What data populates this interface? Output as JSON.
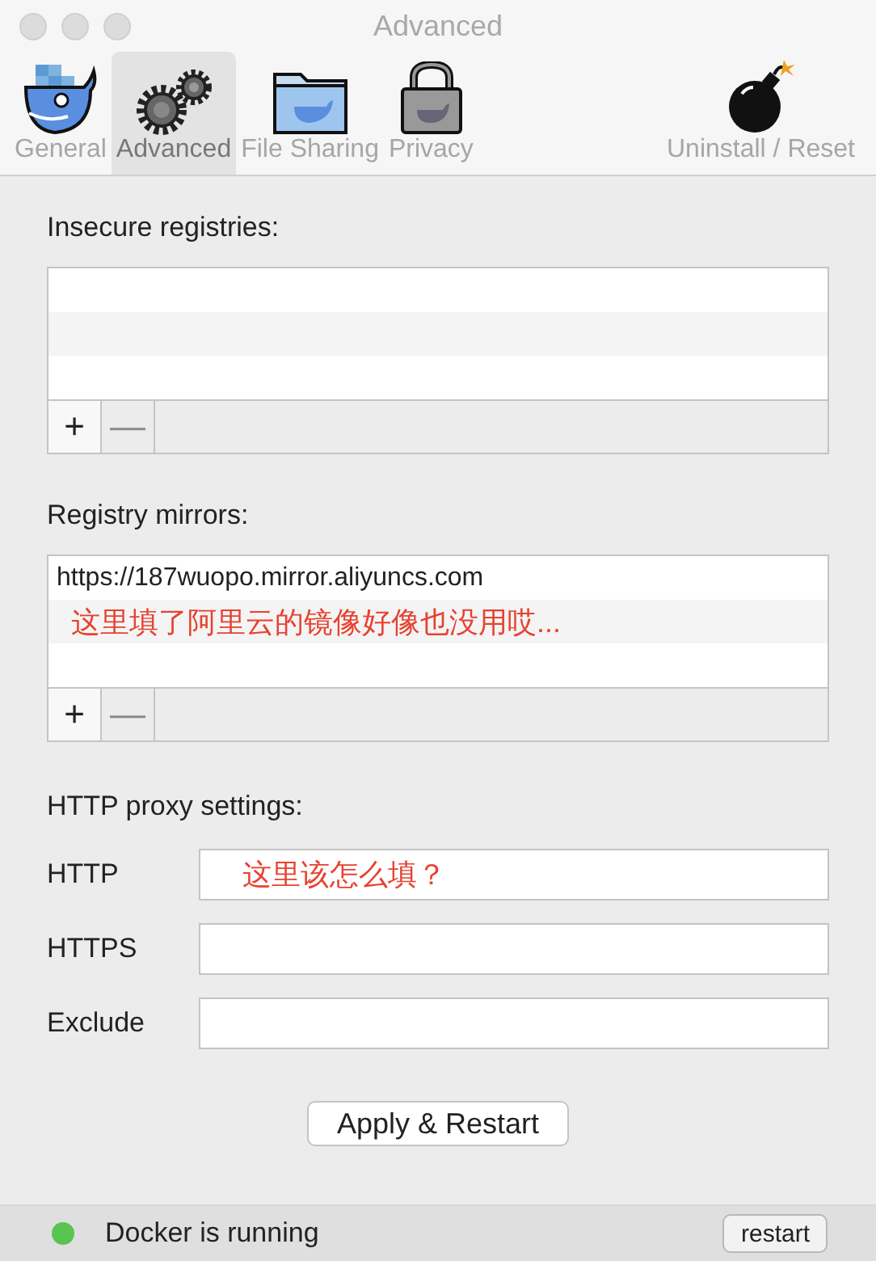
{
  "window": {
    "title": "Advanced"
  },
  "tabs": [
    {
      "label": "General",
      "selected": false
    },
    {
      "label": "Advanced",
      "selected": true
    },
    {
      "label": "File Sharing",
      "selected": false
    },
    {
      "label": "Privacy",
      "selected": false
    },
    {
      "label": "Uninstall / Reset",
      "selected": false
    }
  ],
  "insecure_registries": {
    "label": "Insecure registries:",
    "add": {
      "label": "+",
      "disabled": false
    },
    "remove": {
      "label": "—",
      "disabled": true
    }
  },
  "registry_mirrors": {
    "label": "Registry mirrors:",
    "rows": [
      {
        "text": "https://187wuopo.mirror.aliyuncs.com",
        "kind": "entry"
      },
      {
        "text": "这里填了阿里云的镜像好像也没用哎...",
        "kind": "note"
      }
    ],
    "add": {
      "label": "+",
      "disabled": false
    },
    "remove": {
      "label": "—",
      "disabled": true
    }
  },
  "proxy": {
    "label": "HTTP proxy settings:",
    "fields": [
      {
        "label": "HTTP",
        "note": "这里该怎么填？"
      },
      {
        "label": "HTTPS"
      },
      {
        "label": "Exclude"
      }
    ]
  },
  "apply_button": "Apply & Restart",
  "status_bar": {
    "text": "Docker is running",
    "color": "#5ac451",
    "button": "restart"
  }
}
